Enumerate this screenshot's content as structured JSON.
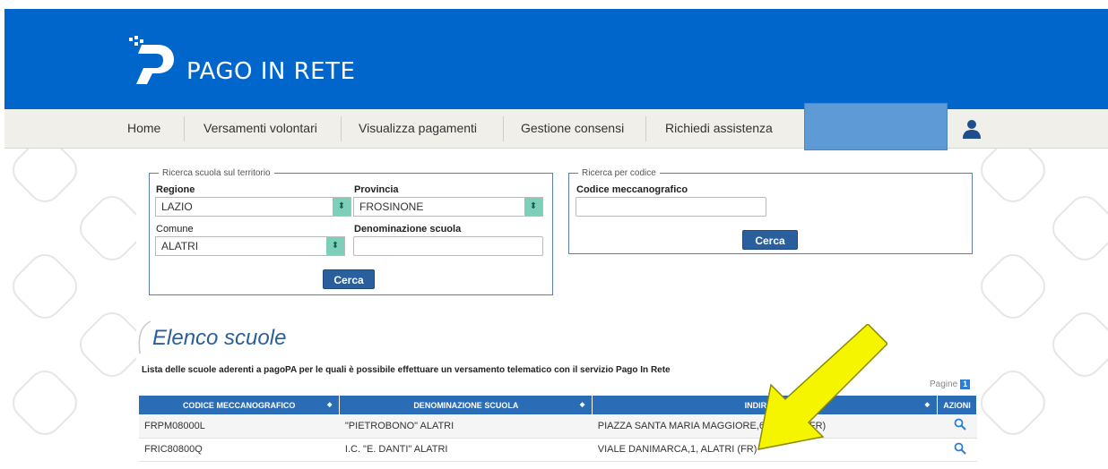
{
  "brand": {
    "app_name": "PAGO IN RETE",
    "header_color": "#0066cc"
  },
  "nav": {
    "items": [
      {
        "label": "Home"
      },
      {
        "label": "Versamenti volontari"
      },
      {
        "label": "Visualizza pagamenti"
      },
      {
        "label": "Gestione consensi"
      },
      {
        "label": "Richiedi assistenza"
      }
    ],
    "user_icon": "user-icon"
  },
  "search_territory": {
    "legend": "Ricerca scuola sul territorio",
    "regione_label": "Regione",
    "regione_value": "LAZIO",
    "provincia_label": "Provincia",
    "provincia_value": "FROSINONE",
    "comune_label": "Comune",
    "comune_value": "ALATRI",
    "denominazione_label": "Denominazione scuola",
    "denominazione_value": "",
    "button": "Cerca"
  },
  "search_code": {
    "legend": "Ricerca per codice",
    "codice_label": "Codice meccanografico",
    "codice_value": "",
    "button": "Cerca"
  },
  "list": {
    "title": "Elenco scuole",
    "description": "Lista delle scuole aderenti a pagoPA per le quali è possibile effettuare un versamento telematico con il servizio Pago In Rete",
    "pagine_label": "Pagine",
    "current_page": "1",
    "columns": [
      "CODICE MECCANOGRAFICO",
      "DENOMINAZIONE SCUOLA",
      "INDIRIZZO",
      "AZIONI"
    ],
    "rows": [
      {
        "codice": "FRPM08000L",
        "denominazione": "\"PIETROBONO\" ALATRI",
        "indirizzo": "PIAZZA SANTA MARIA MAGGIORE,6, ALATRI (FR)"
      },
      {
        "codice": "FRIC80800Q",
        "denominazione": "I.C. \"E. DANTI\" ALATRI",
        "indirizzo": "VIALE DANIMARCA,1, ALATRI (FR)"
      }
    ]
  },
  "annotation": {
    "arrow_color": "#f5f500"
  }
}
